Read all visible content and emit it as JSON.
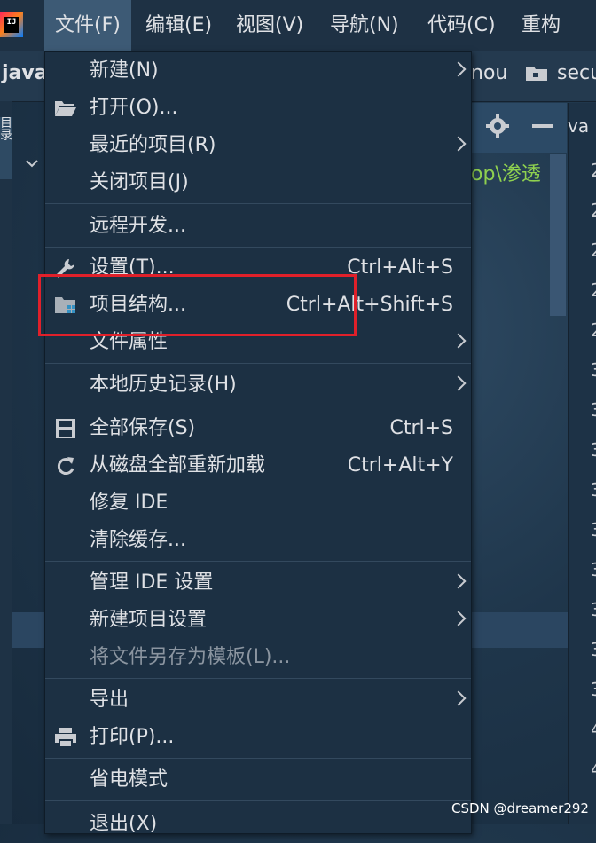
{
  "menubar": {
    "items": [
      {
        "label": "文件(F)",
        "active": true
      },
      {
        "label": "编辑(E)"
      },
      {
        "label": "视图(V)"
      },
      {
        "label": "导航(N)"
      },
      {
        "label": "代码(C)"
      },
      {
        "label": "重构(R)"
      }
    ]
  },
  "navbar": {
    "left_text": "java",
    "right_text": "nou",
    "folder_text": "secu"
  },
  "editor": {
    "tab_fragment": "va",
    "path_text": "op\\渗透",
    "line_numbers": [
      "2",
      "2",
      "2",
      "2",
      "2",
      "3",
      "3",
      "3",
      "3",
      "3",
      "3",
      "3",
      "3",
      "3",
      "4",
      "4"
    ]
  },
  "file_menu": {
    "items": [
      {
        "id": "new",
        "label": "新建(N)",
        "submenu": true
      },
      {
        "id": "open",
        "label": "打开(O)...",
        "icon": "folder-open-icon"
      },
      {
        "id": "recent",
        "label": "最近的项目(R)",
        "submenu": true
      },
      {
        "id": "close",
        "label": "关闭项目(J)"
      },
      {
        "id": "remote",
        "label": "远程开发..."
      },
      {
        "id": "settings",
        "label": "设置(T)...",
        "shortcut": "Ctrl+Alt+S",
        "icon": "wrench-icon"
      },
      {
        "id": "structure",
        "label": "项目结构...",
        "shortcut": "Ctrl+Alt+Shift+S",
        "icon": "project-structure-icon"
      },
      {
        "id": "file-props",
        "label": "文件属性",
        "submenu": true
      },
      {
        "id": "local-history",
        "label": "本地历史记录(H)",
        "submenu": true
      },
      {
        "id": "save-all",
        "label": "全部保存(S)",
        "shortcut": "Ctrl+S",
        "icon": "save-icon"
      },
      {
        "id": "reload",
        "label": "从磁盘全部重新加载",
        "shortcut": "Ctrl+Alt+Y",
        "icon": "reload-icon"
      },
      {
        "id": "repair",
        "label": "修复 IDE"
      },
      {
        "id": "invalidate",
        "label": "清除缓存..."
      },
      {
        "id": "manage-settings",
        "label": "管理 IDE 设置",
        "submenu": true
      },
      {
        "id": "new-project-settings",
        "label": "新建项目设置",
        "submenu": true
      },
      {
        "id": "save-template",
        "label": "将文件另存为模板(L)...",
        "disabled": true
      },
      {
        "id": "export",
        "label": "导出",
        "submenu": true
      },
      {
        "id": "print",
        "label": "打印(P)...",
        "icon": "printer-icon"
      },
      {
        "id": "power-save",
        "label": "省电模式"
      },
      {
        "id": "exit",
        "label": "退出(X)"
      }
    ]
  },
  "colors": {
    "accent_highlight": "#e0202a",
    "menu_bg": "#1c3043",
    "active_menu_bg": "#3d5a75"
  },
  "watermark": "CSDN @dreamer292"
}
